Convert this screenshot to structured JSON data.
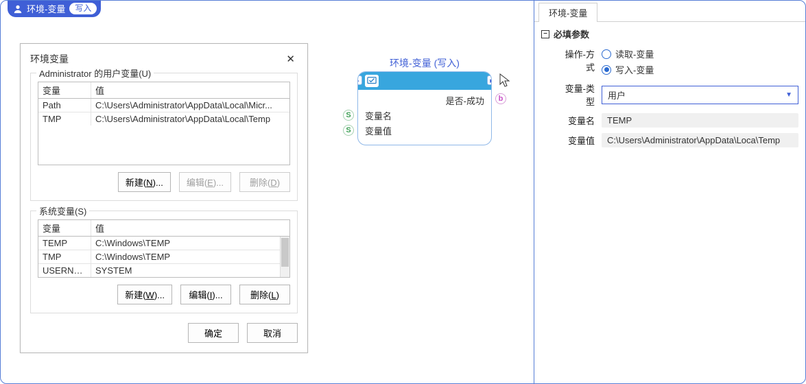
{
  "header": {
    "title": "环境-变量",
    "mode_badge": "写入"
  },
  "dialog": {
    "title": "环境变量",
    "user_section_label": "Administrator 的用户变量(U)",
    "system_section_label": "系统变量(S)",
    "col_var": "变量",
    "col_val": "值",
    "user_rows": [
      {
        "var": "Path",
        "val": "C:\\Users\\Administrator\\AppData\\Local\\Micr..."
      },
      {
        "var": "TMP",
        "val": "C:\\Users\\Administrator\\AppData\\Local\\Temp"
      }
    ],
    "system_rows": [
      {
        "var": "TEMP",
        "val": "C:\\Windows\\TEMP"
      },
      {
        "var": "TMP",
        "val": "C:\\Windows\\TEMP"
      },
      {
        "var": "USERNAME",
        "val": "SYSTEM"
      }
    ],
    "buttons": {
      "new_n_pre": "新建(",
      "new_n_u": "N",
      "new_n_post": ")...",
      "edit_e_pre": "编辑(",
      "edit_e_u": "E",
      "edit_e_post": ")...",
      "delete_d_pre": "删除(",
      "delete_d_u": "D",
      "delete_d_post": ")",
      "new_w_pre": "新建(",
      "new_w_u": "W",
      "new_w_post": ")...",
      "edit_i_pre": "编辑(",
      "edit_i_u": "I",
      "edit_i_post": ")...",
      "delete_l_pre": "删除(",
      "delete_l_u": "L",
      "delete_l_post": ")",
      "ok": "确定",
      "cancel": "取消"
    }
  },
  "node": {
    "title_top": "环境-变量 (写入)",
    "out_success": "是否-成功",
    "in_name": "变量名",
    "in_value": "变量值",
    "port_b": "b",
    "port_s": "S"
  },
  "right_panel": {
    "tab": "环境-变量",
    "section_title": "必填参数",
    "minus": "−",
    "op_mode_label": "操作-方式",
    "radio_read": "读取-变量",
    "radio_write": "写入-变量",
    "var_type_label": "变量-类型",
    "var_type_value": "用户",
    "var_name_label": "变量名",
    "var_name_value": "TEMP",
    "var_value_label": "变量值",
    "var_value_value": "C:\\Users\\Administrator\\AppData\\Loca\\Temp"
  }
}
